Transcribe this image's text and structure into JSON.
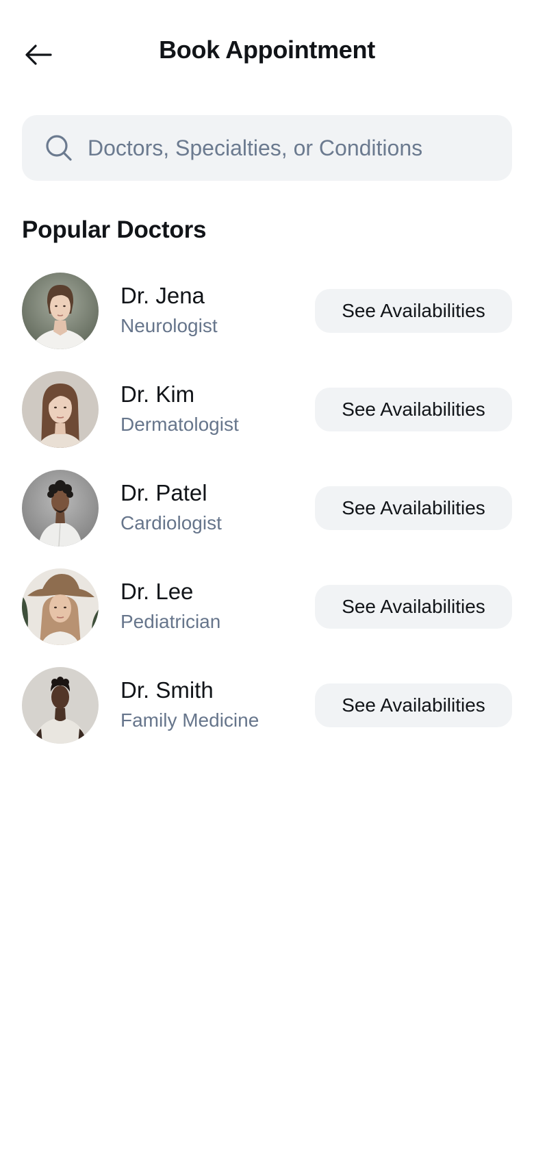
{
  "header": {
    "title": "Book Appointment",
    "back_icon": "arrow-left-icon"
  },
  "search": {
    "placeholder": "Doctors, Specialties, or Conditions",
    "value": "",
    "icon": "search-icon"
  },
  "popular": {
    "title": "Popular Doctors",
    "doctors": [
      {
        "name": "Dr. Jena",
        "specialty": "Neurologist",
        "button_label": "See Availabilities"
      },
      {
        "name": "Dr. Kim",
        "specialty": "Dermatologist",
        "button_label": "See Availabilities"
      },
      {
        "name": "Dr. Patel",
        "specialty": "Cardiologist",
        "button_label": "See Availabilities"
      },
      {
        "name": "Dr. Lee",
        "specialty": "Pediatrician",
        "button_label": "See Availabilities"
      },
      {
        "name": "Dr. Smith",
        "specialty": "Family Medicine",
        "button_label": "See Availabilities"
      }
    ]
  },
  "colors": {
    "text_primary": "#111418",
    "text_secondary": "#66758b",
    "surface": "#f1f3f5",
    "background": "#ffffff"
  }
}
